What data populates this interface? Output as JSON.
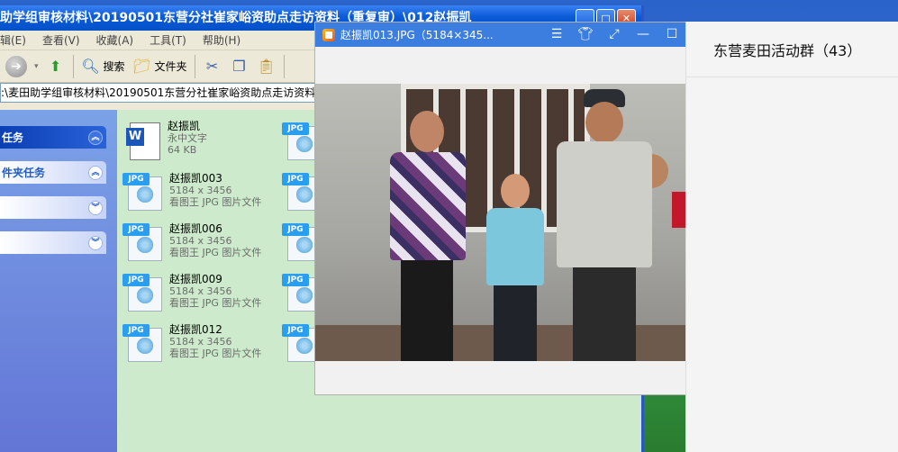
{
  "explorer": {
    "title": "助学组审核材料\\20190501东营分社崔家峪资助点走访资料（重复审）\\012赵振凯",
    "menu": [
      "辑(E)",
      "查看(V)",
      "收藏(A)",
      "工具(T)",
      "帮助(H)"
    ],
    "toolbar": {
      "search": "搜索",
      "folders": "文件夹"
    },
    "address": ":\\麦田助学组审核材料\\20190501东营分社崔家峪资助点走访资料（",
    "tasks": [
      {
        "label": "任务",
        "style": "dark"
      },
      {
        "label": "件夹任务",
        "style": "light"
      },
      {
        "label": "",
        "style": "light"
      },
      {
        "label": "",
        "style": "light"
      }
    ],
    "files": [
      {
        "name": "赵振凯",
        "line2": "永中文字",
        "line3": "64 KB",
        "type": "doc"
      },
      {
        "name": "赵振凯003",
        "line2": "5184 x 3456",
        "line3": "看图王 JPG 图片文件",
        "type": "jpg"
      },
      {
        "name": "赵振凯006",
        "line2": "5184 x 3456",
        "line3": "看图王 JPG 图片文件",
        "type": "jpg"
      },
      {
        "name": "赵振凯009",
        "line2": "5184 x 3456",
        "line3": "看图王 JPG 图片文件",
        "type": "jpg"
      },
      {
        "name": "赵振凯012",
        "line2": "5184 x 3456",
        "line3": "看图王 JPG 图片文件",
        "type": "jpg"
      }
    ],
    "jpg_tag": "JPG",
    "doc_tag": "W"
  },
  "viewer": {
    "title": "赵振凯013.JPG（5184×345..."
  },
  "chat": {
    "title": "东营麦田活动群（43）"
  },
  "colors": {
    "xp_blue": "#0a5bd8",
    "task_pane": "#6f8ee0",
    "file_bg": "#cdebcc",
    "viewer_blue": "#3c7de0"
  }
}
